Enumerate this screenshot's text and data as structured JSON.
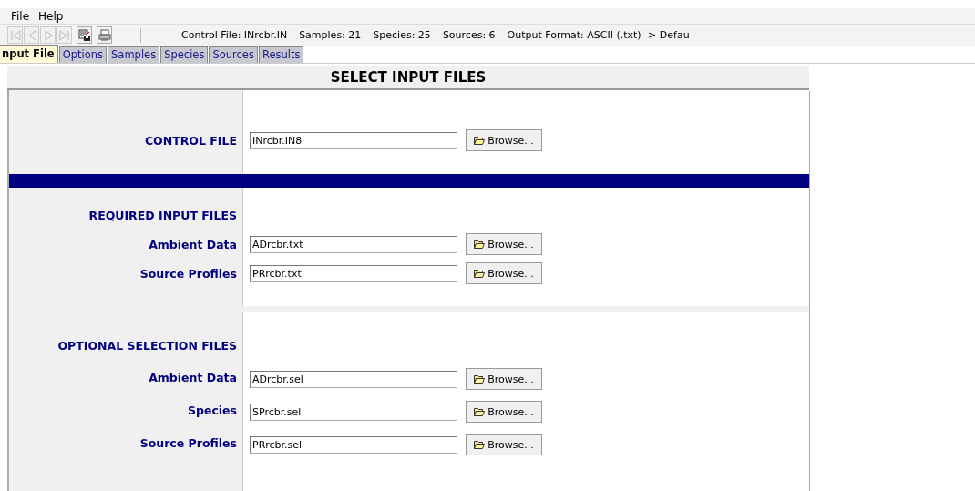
{
  "menu": [
    "File",
    "Help"
  ],
  "toolbar": {
    "buttons": [
      {
        "kind": "first",
        "disabled": true
      },
      {
        "kind": "prev",
        "disabled": true
      },
      {
        "kind": "next",
        "disabled": true
      },
      {
        "kind": "last",
        "disabled": true
      },
      {
        "kind": "save",
        "disabled": false
      },
      {
        "kind": "print",
        "disabled": false
      }
    ],
    "status": [
      "Control File: INrcbr.IN",
      "Samples: 21",
      "Species: 25",
      "Sources: 6",
      "Output Format: ASCII (.txt) -> Defau"
    ]
  },
  "tabs": [
    {
      "label": "nput File",
      "selected": true
    },
    {
      "label": "Options",
      "selected": false
    },
    {
      "label": "Samples",
      "selected": false
    },
    {
      "label": "Species",
      "selected": false
    },
    {
      "label": "Sources",
      "selected": false
    },
    {
      "label": "Results",
      "selected": false
    }
  ],
  "title": "SELECT INPUT FILES",
  "sections": [
    {
      "kind": "control",
      "rows": [
        {
          "kind": "file",
          "label": "CONTROL FILE",
          "value": "INrcbr.IN8",
          "button": "Browse..."
        }
      ]
    },
    {
      "kind": "required",
      "rows": [
        {
          "kind": "heading",
          "label": "REQUIRED INPUT FILES"
        },
        {
          "kind": "file",
          "label": "Ambient Data",
          "value": "ADrcbr.txt",
          "button": "Browse..."
        },
        {
          "kind": "file",
          "label": "Source Profiles",
          "value": "PRrcbr.txt",
          "button": "Browse..."
        }
      ]
    },
    {
      "kind": "optional",
      "rows": [
        {
          "kind": "heading",
          "label": "OPTIONAL SELECTION FILES"
        },
        {
          "kind": "file",
          "label": "Ambient Data",
          "value": "ADrcbr.sel",
          "button": "Browse..."
        },
        {
          "kind": "file",
          "label": "Species",
          "value": "SPrcbr.sel",
          "button": "Browse..."
        },
        {
          "kind": "file",
          "label": "Source Profiles",
          "value": "PRrcbr.sel",
          "button": "Browse..."
        }
      ]
    }
  ]
}
